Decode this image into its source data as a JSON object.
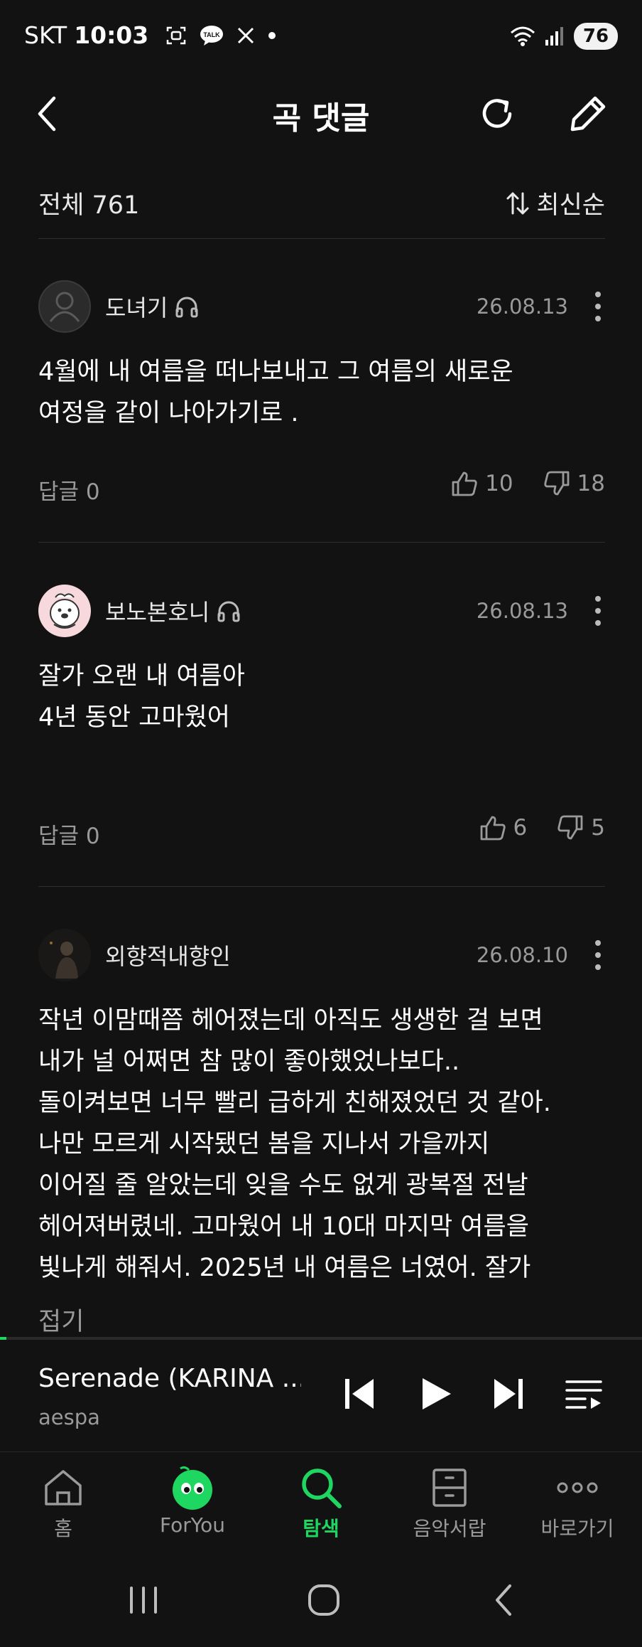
{
  "status_bar": {
    "carrier": "SKT",
    "time": "10:03",
    "battery": "76",
    "icons": [
      "screenshot-icon",
      "talk-icon",
      "x-icon",
      "dot-icon",
      "wifi-icon",
      "signal-icon"
    ],
    "talk_badge": "TALK"
  },
  "header": {
    "title": "곡 댓글"
  },
  "summary": {
    "total": "전체 761",
    "sort": "최신순"
  },
  "comments": [
    {
      "name": "도녀기",
      "date": "26.08.13",
      "lines": [
        "4월에 내 여름을 떠나보내고 그 여름의 새로운",
        "여정을 같이 나아가기로 ."
      ],
      "reply": "답글 0",
      "likes": "10",
      "dislikes": "18"
    },
    {
      "name": "보노본호니",
      "date": "26.08.13",
      "lines": [
        "잘가 오랜 내 여름아",
        "4년 동안 고마웠어"
      ],
      "reply": "답글 0",
      "likes": "6",
      "dislikes": "5"
    },
    {
      "name": "외향적내향인",
      "date": "26.08.10",
      "lines": [
        "작년 이맘때쯤 헤어졌는데 아직도 생생한 걸 보면",
        "내가 널 어쩌면 참 많이 좋아했었나보다..",
        "돌이켜보면 너무 빨리 급하게 친해졌었던 것 같아.",
        "나만 모르게 시작됐던 봄을 지나서 가을까지",
        "이어질 줄 알았는데 잊을 수도 없게 광복절 전날",
        "헤어져버렸네. 고마웠어 내 10대 마지막 여름을",
        "빛나게 해줘서. 2025년 내 여름은 너였어. 잘가"
      ],
      "fold": "접기"
    }
  ],
  "player": {
    "title": "Serenade (KARINA ...",
    "artist": "aespa",
    "progress": 0.01
  },
  "nav": {
    "items": [
      {
        "label": "홈",
        "icon": "home-icon"
      },
      {
        "label": "ForYou",
        "icon": "foryou-icon"
      },
      {
        "label": "탐색",
        "icon": "search-icon"
      },
      {
        "label": "음악서랍",
        "icon": "drawer-icon"
      },
      {
        "label": "바로가기",
        "icon": "more-icon"
      }
    ],
    "active": "탐색"
  },
  "colors": {
    "background": "#121212",
    "accent": "#1ed760",
    "muted": "#9a9a9a",
    "divider": "#2e2e2e"
  }
}
